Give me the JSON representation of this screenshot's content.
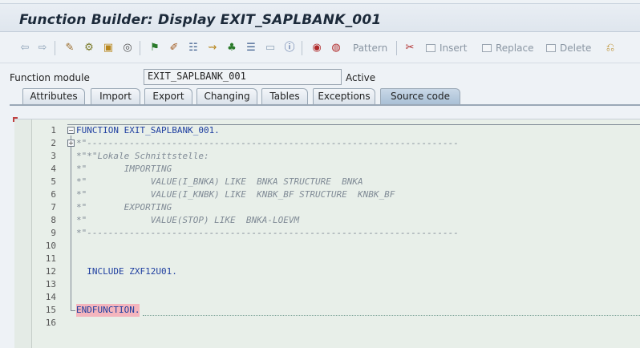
{
  "window": {
    "title": "Function Builder: Display EXIT_SAPLBANK_001"
  },
  "toolbar": {
    "pattern_label": "Pattern",
    "insert_label": "Insert",
    "replace_label": "Replace",
    "delete_label": "Delete"
  },
  "function_module": {
    "label": "Function module",
    "value": "EXIT_SAPLBANK_001",
    "status": "Active"
  },
  "tabs": [
    {
      "label": "Attributes"
    },
    {
      "label": "Import"
    },
    {
      "label": "Export"
    },
    {
      "label": "Changing"
    },
    {
      "label": "Tables"
    },
    {
      "label": "Exceptions"
    },
    {
      "label": "Source code"
    }
  ],
  "active_tab": "Source code",
  "code_lines": [
    {
      "num": "1",
      "text": "FUNCTION EXIT_SAPLBANK_001."
    },
    {
      "num": "2",
      "text": "*\"----------------------------------------------------------------------"
    },
    {
      "num": "3",
      "text": "*\"*\"Lokale Schnittstelle:"
    },
    {
      "num": "4",
      "text": "*\"       IMPORTING"
    },
    {
      "num": "5",
      "text": "*\"            VALUE(I_BNKA) LIKE  BNKA STRUCTURE  BNKA"
    },
    {
      "num": "6",
      "text": "*\"            VALUE(I_KNBK) LIKE  KNBK_BF STRUCTURE  KNBK_BF"
    },
    {
      "num": "7",
      "text": "*\"       EXPORTING"
    },
    {
      "num": "8",
      "text": "*\"            VALUE(STOP) LIKE  BNKA-LOEVM"
    },
    {
      "num": "9",
      "text": "*\"----------------------------------------------------------------------"
    },
    {
      "num": "10",
      "text": ""
    },
    {
      "num": "11",
      "text": ""
    },
    {
      "num": "12",
      "text": "  INCLUDE ZXF12U01."
    },
    {
      "num": "13",
      "text": ""
    },
    {
      "num": "14",
      "text": ""
    },
    {
      "num": "15",
      "text": "ENDFUNCTION."
    },
    {
      "num": "16",
      "text": ""
    }
  ],
  "colors": {
    "keyword": "#1f3fa0",
    "comment": "#808b96",
    "endfunction_highlight": "#f4b5bd",
    "active_tab": "#a9c0d6"
  }
}
